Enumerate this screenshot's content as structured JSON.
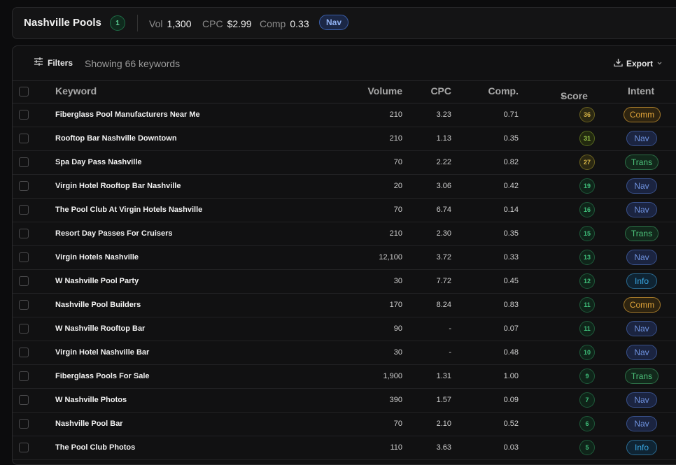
{
  "header": {
    "title": "Nashville Pools",
    "count": "1",
    "vol_label": "Vol",
    "vol_value": "1,300",
    "cpc_label": "CPC",
    "cpc_value": "$2.99",
    "comp_label": "Comp",
    "comp_value": "0.33",
    "intent": "Nav"
  },
  "toolbar": {
    "filters_label": "Filters",
    "showing_text": "Showing 66 keywords",
    "export_label": "Export"
  },
  "columns": {
    "keyword": "Keyword",
    "volume": "Volume",
    "cpc": "CPC",
    "comp": "Comp.",
    "score": "Score",
    "intent": "Intent"
  },
  "colors": {
    "comm": "#e0a43a",
    "nav": "#6f93e0",
    "trans": "#4cc07a",
    "info": "#39a9e6",
    "score_high": "#d9b648",
    "score_mid": "#9cc94a",
    "score_low": "#3fbf7a"
  },
  "rows": [
    {
      "keyword": "Fiberglass Pool Manufacturers Near Me",
      "volume": "210",
      "cpc": "3.23",
      "comp": "0.71",
      "score": "36",
      "intent": "Comm"
    },
    {
      "keyword": "Rooftop Bar Nashville Downtown",
      "volume": "210",
      "cpc": "1.13",
      "comp": "0.35",
      "score": "31",
      "intent": "Nav"
    },
    {
      "keyword": "Spa Day Pass Nashville",
      "volume": "70",
      "cpc": "2.22",
      "comp": "0.82",
      "score": "27",
      "intent": "Trans"
    },
    {
      "keyword": "Virgin Hotel Rooftop Bar Nashville",
      "volume": "20",
      "cpc": "3.06",
      "comp": "0.42",
      "score": "19",
      "intent": "Nav"
    },
    {
      "keyword": "The Pool Club At Virgin Hotels Nashville",
      "volume": "70",
      "cpc": "6.74",
      "comp": "0.14",
      "score": "16",
      "intent": "Nav"
    },
    {
      "keyword": "Resort Day Passes For Cruisers",
      "volume": "210",
      "cpc": "2.30",
      "comp": "0.35",
      "score": "15",
      "intent": "Trans"
    },
    {
      "keyword": "Virgin Hotels Nashville",
      "volume": "12,100",
      "cpc": "3.72",
      "comp": "0.33",
      "score": "13",
      "intent": "Nav"
    },
    {
      "keyword": "W Nashville Pool Party",
      "volume": "30",
      "cpc": "7.72",
      "comp": "0.45",
      "score": "12",
      "intent": "Info"
    },
    {
      "keyword": "Nashville Pool Builders",
      "volume": "170",
      "cpc": "8.24",
      "comp": "0.83",
      "score": "11",
      "intent": "Comm"
    },
    {
      "keyword": "W Nashville Rooftop Bar",
      "volume": "90",
      "cpc": "-",
      "comp": "0.07",
      "score": "11",
      "intent": "Nav"
    },
    {
      "keyword": "Virgin Hotel Nashville Bar",
      "volume": "30",
      "cpc": "-",
      "comp": "0.48",
      "score": "10",
      "intent": "Nav"
    },
    {
      "keyword": "Fiberglass Pools For Sale",
      "volume": "1,900",
      "cpc": "1.31",
      "comp": "1.00",
      "score": "9",
      "intent": "Trans"
    },
    {
      "keyword": "W Nashville Photos",
      "volume": "390",
      "cpc": "1.57",
      "comp": "0.09",
      "score": "7",
      "intent": "Nav"
    },
    {
      "keyword": "Nashville Pool Bar",
      "volume": "70",
      "cpc": "2.10",
      "comp": "0.52",
      "score": "6",
      "intent": "Nav"
    },
    {
      "keyword": "The Pool Club Photos",
      "volume": "110",
      "cpc": "3.63",
      "comp": "0.03",
      "score": "5",
      "intent": "Info"
    }
  ]
}
